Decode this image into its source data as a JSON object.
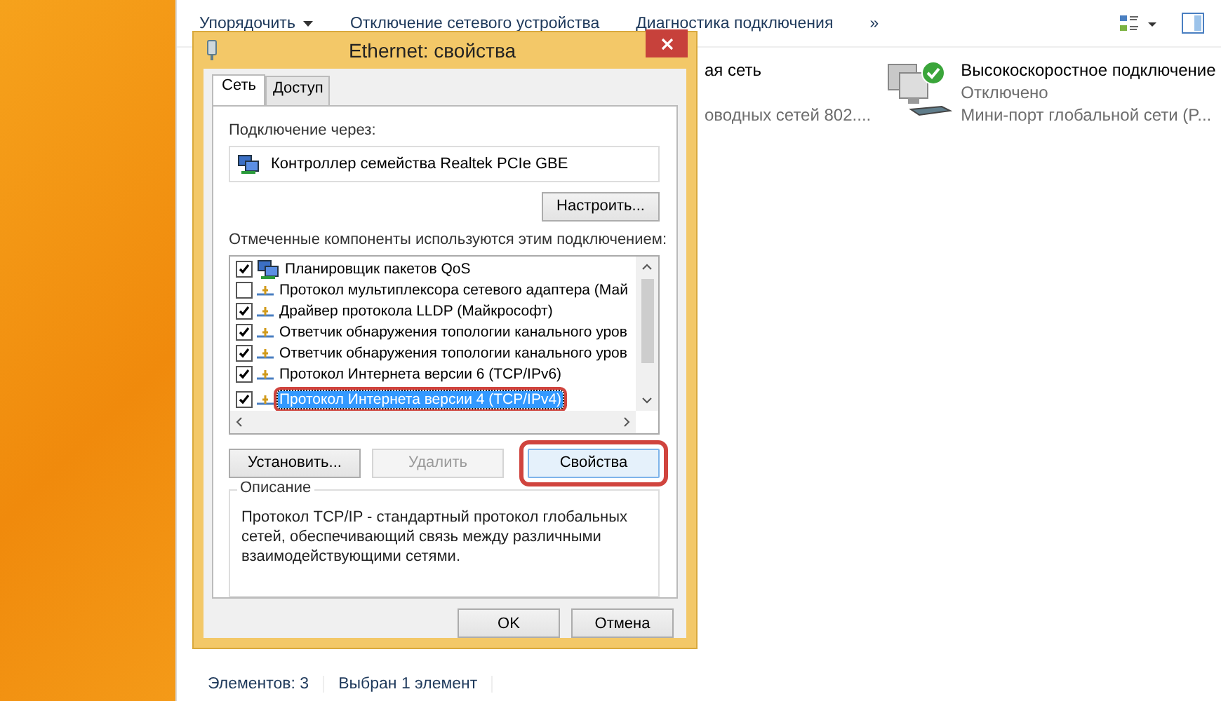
{
  "explorer": {
    "toolbar": [
      {
        "label": "Упорядочить",
        "kind": "dropdown"
      },
      {
        "label": "Отключение сетевого устройства",
        "kind": "plain"
      },
      {
        "label": "Диагностика подключения",
        "kind": "plain"
      },
      {
        "label": "»",
        "kind": "plain"
      }
    ],
    "connections": [
      {
        "name": "ая сеть",
        "device": "оводных сетей 802....",
        "kind": "partial"
      },
      {
        "name": "Высокоскоростное подключение",
        "status": "Отключено",
        "device": "Мини-порт глобальной сети (P...",
        "kind": "full"
      }
    ],
    "status_bar": [
      "Элементов: 3",
      "Выбран 1 элемент"
    ]
  },
  "dialog": {
    "title": "Ethernet: свойства",
    "tabs": [
      {
        "label": "Сеть",
        "selected": true
      },
      {
        "label": "Доступ",
        "selected": false
      }
    ],
    "connect_label": "Подключение через:",
    "adapter": "Контроллер семейства Realtek PCIe GBE",
    "configure_button": "Настроить...",
    "components_label": "Отмеченные компоненты используются этим подключением:",
    "components": [
      {
        "label": "Планировщик пакетов QoS",
        "checked": true,
        "selected": false,
        "marked": false,
        "kind": "service"
      },
      {
        "label": "Протокол мультиплексора сетевого адаптера (Май",
        "checked": false,
        "selected": false,
        "marked": false,
        "kind": "protocol"
      },
      {
        "label": "Драйвер протокола LLDP (Майкрософт)",
        "checked": true,
        "selected": false,
        "marked": false,
        "kind": "protocol"
      },
      {
        "label": "Ответчик обнаружения топологии канального уров",
        "checked": true,
        "selected": false,
        "marked": false,
        "kind": "protocol"
      },
      {
        "label": "Ответчик обнаружения топологии канального уров",
        "checked": true,
        "selected": false,
        "marked": false,
        "kind": "protocol"
      },
      {
        "label": "Протокол Интернета версии 6 (TCP/IPv6)",
        "checked": true,
        "selected": false,
        "marked": false,
        "kind": "protocol"
      },
      {
        "label": "Протокол Интернета версии 4 (TCP/IPv4)",
        "checked": true,
        "selected": true,
        "marked": true,
        "kind": "protocol"
      }
    ],
    "action_buttons": [
      {
        "label": "Установить...",
        "disabled": false,
        "marked": false
      },
      {
        "label": "Удалить",
        "disabled": true,
        "marked": false
      },
      {
        "label": "Свойства",
        "disabled": false,
        "marked": true
      }
    ],
    "description_title": "Описание",
    "description": "Протокол TCP/IP - стандартный протокол глобальных сетей, обеспечивающий связь между различными взаимодействующими сетями.",
    "buttons": [
      "OK",
      "Отмена"
    ]
  }
}
